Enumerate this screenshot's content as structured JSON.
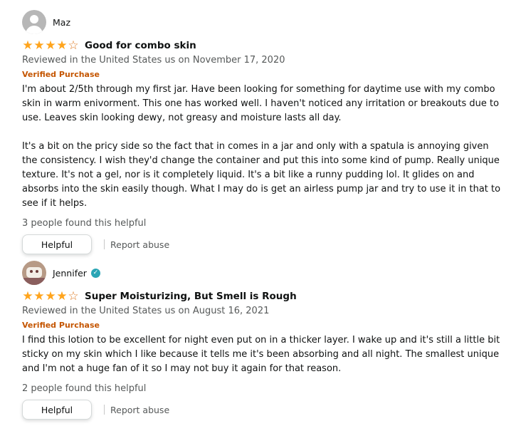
{
  "reviews": [
    {
      "name": "Maz",
      "verified_badge": false,
      "rating": 4,
      "title": "Good for combo skin",
      "meta": "Reviewed in the United States us on November 17, 2020",
      "verified": "Verified Purchase",
      "paragraphs": [
        "I'm about 2/5th through my first jar. Have been looking for something for daytime use with my combo skin in warm enivorment. This one has worked well. I haven't noticed any irritation or breakouts due to use. Leaves skin looking dewy, not greasy and moisture lasts all day.",
        "It's a bit on the pricy side so the fact that in comes in a jar and only with a spatula is annoying given the consistency. I wish they'd change the container and put this into some kind of pump. Really unique texture. It's not a gel, nor is it completely liquid. It's a bit like a runny pudding lol. It glides on and absorbs into the skin easily though. What I may do is get an airless pump jar and try to use it in that to see if it helps."
      ],
      "helpful_count": "3 people found this helpful",
      "helpful_label": "Helpful",
      "report_label": "Report abuse"
    },
    {
      "name": "Jennifer",
      "verified_badge": true,
      "rating": 4,
      "title": "Super Moisturizing, But Smell is Rough",
      "meta": "Reviewed in the United States us on August 16, 2021",
      "verified": "Verified Purchase",
      "paragraphs": [
        "I find this lotion to be excellent for night even put on in a thicker layer. I wake up and it's still a little bit sticky on my skin which I like because it tells me it's been absorbing and all night. The smallest unique and I'm not a huge fan of it so I may not buy it again for that reason."
      ],
      "helpful_count": "2 people found this helpful",
      "helpful_label": "Helpful",
      "report_label": "Report abuse"
    }
  ],
  "colors": {
    "star": "#ffa41c",
    "verified": "#c45500",
    "badge": "#2aa5b5"
  },
  "icons": {
    "star_full": "star-icon",
    "star_empty": "star-outline-icon",
    "badge": "verified-badge-icon",
    "avatar_default": "default-avatar-icon"
  }
}
